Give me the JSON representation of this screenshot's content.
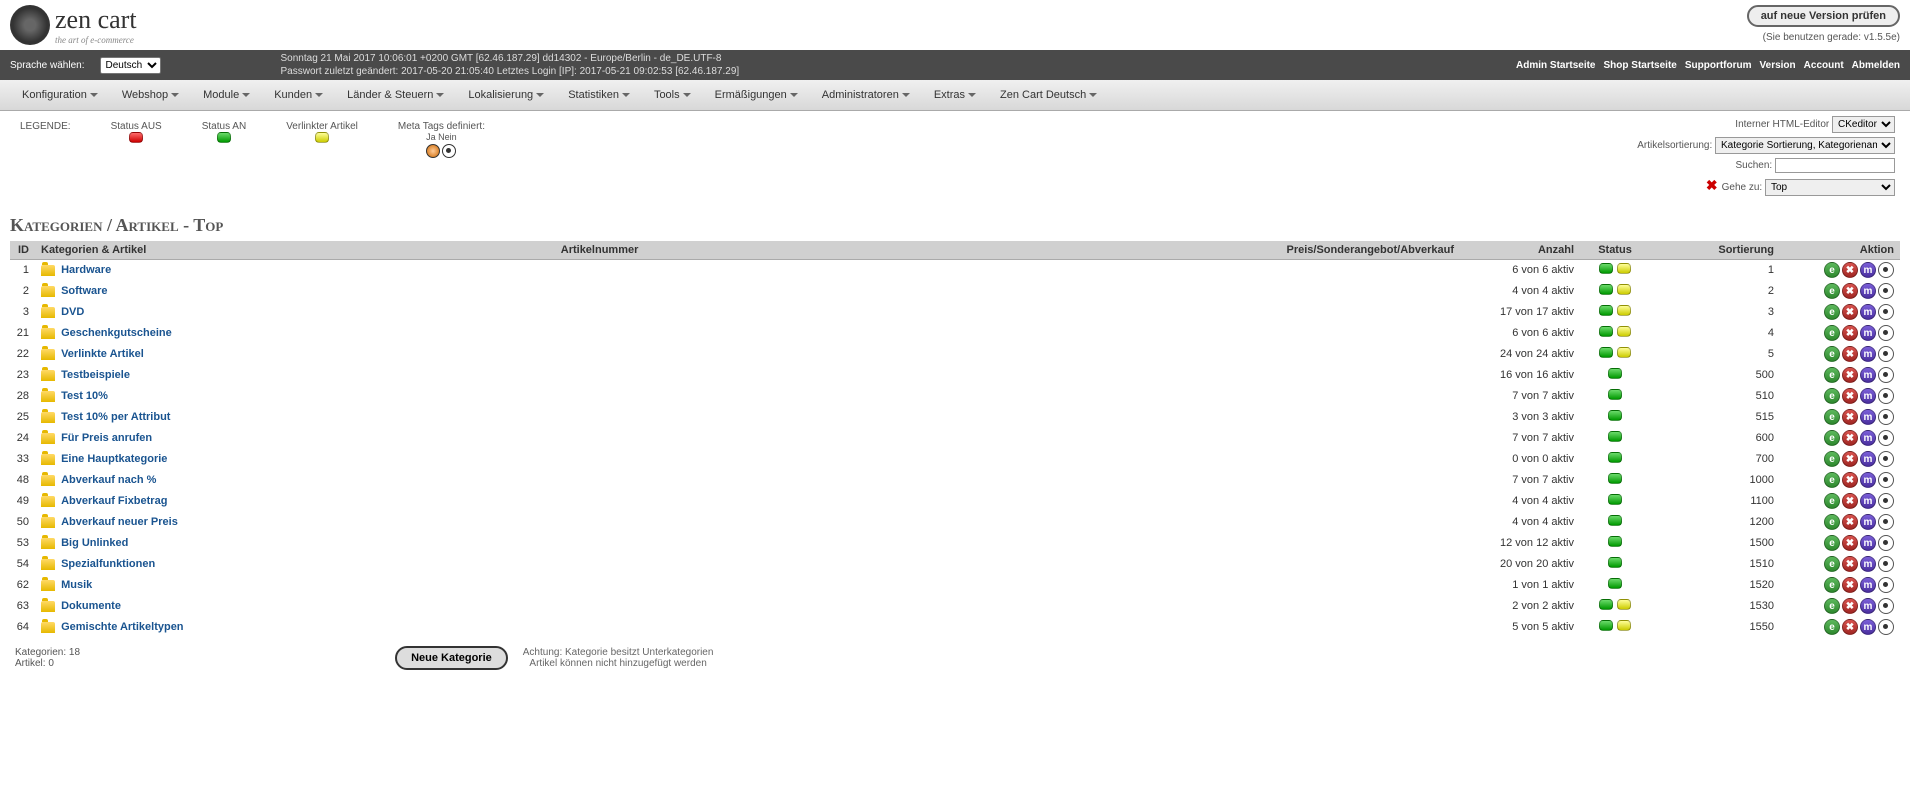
{
  "logo": {
    "main": "zen cart",
    "tag": "the art of e-commerce"
  },
  "version_btn": "auf neue Version prüfen",
  "version_txt": "(Sie benutzen gerade: v1.5.5e)",
  "lang_label": "Sprache wählen:",
  "lang_value": "Deutsch",
  "info_line1": "Sonntag 21 Mai 2017 10:06:01 +0200 GMT [62.46.187.29]  dd14302 - Europe/Berlin - de_DE.UTF-8",
  "info_line2": "Passwort zuletzt geändert: 2017-05-20 21:05:40   Letztes Login [IP]: 2017-05-21 09:02:53 [62.46.187.29]",
  "top_links": [
    "Admin Startseite",
    "Shop Startseite",
    "Supportforum",
    "Version",
    "Account",
    "Abmelden"
  ],
  "menu": [
    "Konfiguration",
    "Webshop",
    "Module",
    "Kunden",
    "Länder & Steuern",
    "Lokalisierung",
    "Statistiken",
    "Tools",
    "Ermäßigungen",
    "Administratoren",
    "Extras",
    "Zen Cart Deutsch"
  ],
  "legend": {
    "title": "LEGENDE:",
    "off": "Status AUS",
    "on": "Status AN",
    "linked": "Verlinkter Artikel",
    "meta": "Meta Tags definiert:",
    "meta_sub": "Ja Nein"
  },
  "ctrl": {
    "editor_lbl": "Interner HTML-Editor",
    "editor_val": "CKeditor",
    "sort_lbl": "Artikelsortierung:",
    "sort_val": "Kategorie Sortierung, Kategoriename",
    "search_lbl": "Suchen:",
    "goto_lbl": "Gehe zu:",
    "goto_val": "Top"
  },
  "page_title": "Kategorien / Artikel - Top",
  "th": {
    "id": "ID",
    "name": "Kategorien & Artikel",
    "sku": "Artikelnummer",
    "price": "Preis/Sonderangebot/Abverkauf",
    "qty": "Anzahl",
    "status": "Status",
    "sort": "Sortierung",
    "act": "Aktion"
  },
  "rows": [
    {
      "id": "1",
      "name": "Hardware",
      "qty": "6 von 6 aktiv",
      "linked": true,
      "sort": "1"
    },
    {
      "id": "2",
      "name": "Software",
      "qty": "4 von 4 aktiv",
      "linked": true,
      "sort": "2"
    },
    {
      "id": "3",
      "name": "DVD",
      "qty": "17 von 17 aktiv",
      "linked": true,
      "sort": "3"
    },
    {
      "id": "21",
      "name": "Geschenkgutscheine",
      "qty": "6 von 6 aktiv",
      "linked": true,
      "sort": "4"
    },
    {
      "id": "22",
      "name": "Verlinkte Artikel",
      "qty": "24 von 24 aktiv",
      "linked": true,
      "sort": "5"
    },
    {
      "id": "23",
      "name": "Testbeispiele",
      "qty": "16 von 16 aktiv",
      "linked": false,
      "sort": "500"
    },
    {
      "id": "28",
      "name": "Test 10%",
      "qty": "7 von 7 aktiv",
      "linked": false,
      "sort": "510"
    },
    {
      "id": "25",
      "name": "Test 10% per Attribut",
      "qty": "3 von 3 aktiv",
      "linked": false,
      "sort": "515"
    },
    {
      "id": "24",
      "name": "Für Preis anrufen",
      "qty": "7 von 7 aktiv",
      "linked": false,
      "sort": "600"
    },
    {
      "id": "33",
      "name": "Eine Hauptkategorie",
      "qty": "0 von 0 aktiv",
      "linked": false,
      "sort": "700"
    },
    {
      "id": "48",
      "name": "Abverkauf nach %",
      "qty": "7 von 7 aktiv",
      "linked": false,
      "sort": "1000"
    },
    {
      "id": "49",
      "name": "Abverkauf Fixbetrag",
      "qty": "4 von 4 aktiv",
      "linked": false,
      "sort": "1100"
    },
    {
      "id": "50",
      "name": "Abverkauf neuer Preis",
      "qty": "4 von 4 aktiv",
      "linked": false,
      "sort": "1200"
    },
    {
      "id": "53",
      "name": "Big Unlinked",
      "qty": "12 von 12 aktiv",
      "linked": false,
      "sort": "1500"
    },
    {
      "id": "54",
      "name": "Spezialfunktionen",
      "qty": "20 von 20 aktiv",
      "linked": false,
      "sort": "1510"
    },
    {
      "id": "62",
      "name": "Musik",
      "qty": "1 von 1 aktiv",
      "linked": false,
      "sort": "1520"
    },
    {
      "id": "63",
      "name": "Dokumente",
      "qty": "2 von 2 aktiv",
      "linked": true,
      "sort": "1530"
    },
    {
      "id": "64",
      "name": "Gemischte Artikeltypen",
      "qty": "5 von 5 aktiv",
      "linked": true,
      "sort": "1550"
    }
  ],
  "footer": {
    "count1": "Kategorien: 18",
    "count2": "Artikel: 0",
    "btn": "Neue Kategorie",
    "warn1": "Achtung: Kategorie besitzt Unterkategorien",
    "warn2": "Artikel können nicht hinzugefügt werden"
  }
}
